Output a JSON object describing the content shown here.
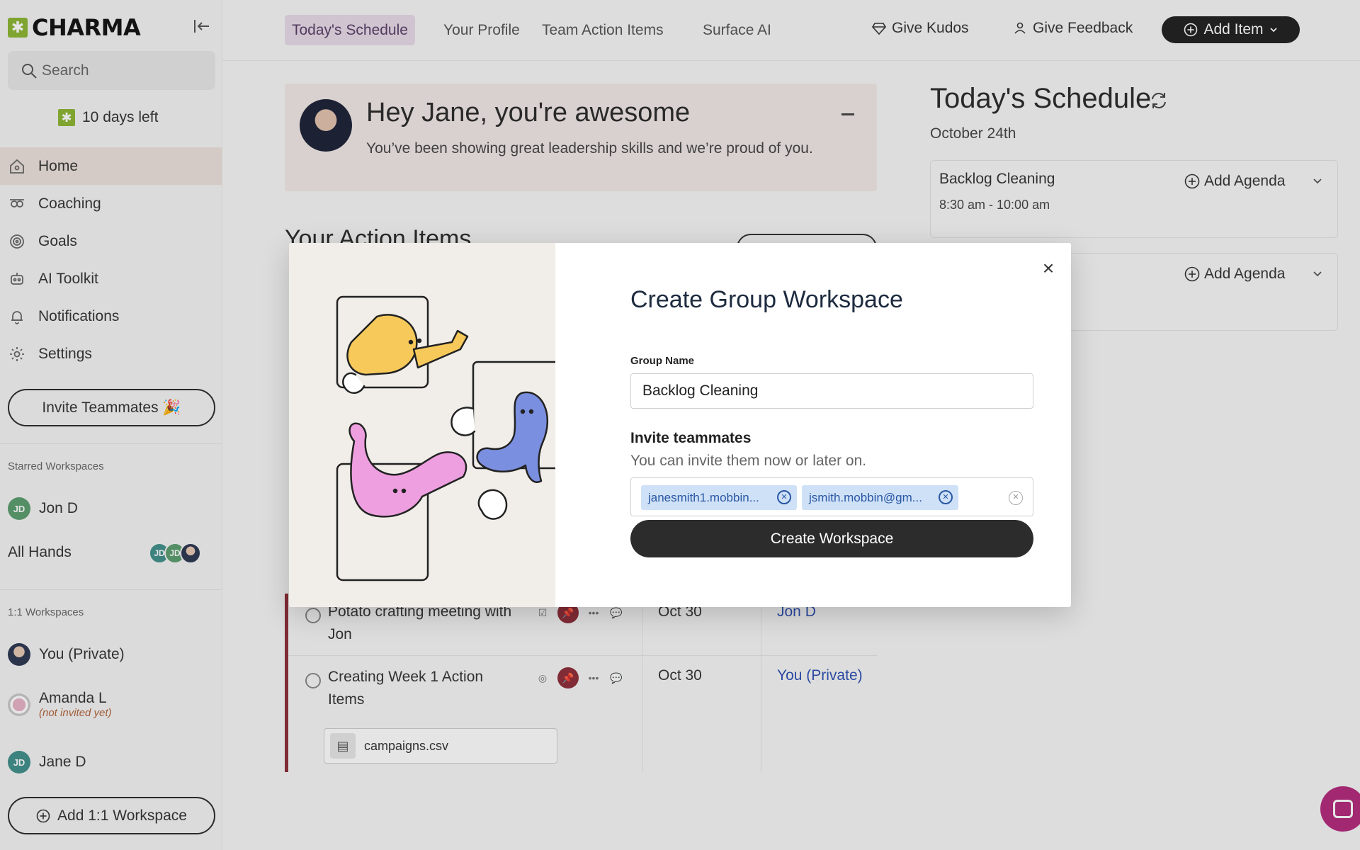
{
  "app": {
    "logo_text": "CHARMA",
    "brand_color": "#8bb531"
  },
  "sidebar": {
    "search_placeholder": "Search",
    "trial_text": "10 days left",
    "nav": [
      {
        "label": "Home",
        "icon": "home-icon"
      },
      {
        "label": "Coaching",
        "icon": "coaching-icon"
      },
      {
        "label": "Goals",
        "icon": "target-icon"
      },
      {
        "label": "AI Toolkit",
        "icon": "robot-icon"
      },
      {
        "label": "Notifications",
        "icon": "bell-icon"
      },
      {
        "label": "Settings",
        "icon": "gear-icon"
      }
    ],
    "invite_label": "Invite Teammates 🎉",
    "starred_label": "Starred Workspaces",
    "starred": [
      {
        "name": "Jon D",
        "initials": "JD"
      },
      {
        "name": "All Hands",
        "avatars": [
          "JD",
          "JD"
        ]
      }
    ],
    "one_on_one_label": "1:1 Workspaces",
    "one_on_one": [
      {
        "name": "You (Private)"
      },
      {
        "name": "Amanda L",
        "sub": "(not invited yet)"
      },
      {
        "name": "Jane D",
        "initials": "JD"
      }
    ],
    "add_workspace_label": "Add 1:1 Workspace"
  },
  "topbar": {
    "tabs": [
      "Today's Schedule",
      "Your Profile",
      "Team Action Items",
      "Surface AI"
    ],
    "active_tab": "Today's Schedule",
    "give_kudos": "Give Kudos",
    "give_feedback": "Give Feedback",
    "add_item": "Add Item"
  },
  "banner": {
    "heading": "Hey Jane, you're awesome",
    "message": "You’ve been showing great leadership skills and we’re proud of you."
  },
  "action_items": {
    "title": "Your Action Items",
    "rows": [
      {
        "title": "Potato crafting meeting with Jon",
        "date": "Oct 30",
        "owner": "Jon D"
      },
      {
        "title": "Creating Week 1 Action Items",
        "date": "Oct 30",
        "owner": "You (Private)",
        "attachment": "campaigns.csv"
      }
    ],
    "accent": "#8c2c37"
  },
  "schedule": {
    "title": "Today's Schedule",
    "date": "October 24th",
    "cards": [
      {
        "title": "Backlog Cleaning",
        "time": "8:30 am - 10:00 am",
        "agenda_label": "Add Agenda"
      },
      {
        "title": "",
        "time": "",
        "agenda_label": "Add Agenda"
      }
    ]
  },
  "modal": {
    "title": "Create Group Workspace",
    "group_name_label": "Group Name",
    "group_name_value": "Backlog Cleaning",
    "invite_heading": "Invite teammates",
    "invite_sub": "You can invite them now or later on.",
    "invitees": [
      "janesmith1.mobbin...",
      "jsmith.mobbin@gm..."
    ],
    "create_label": "Create Workspace"
  }
}
